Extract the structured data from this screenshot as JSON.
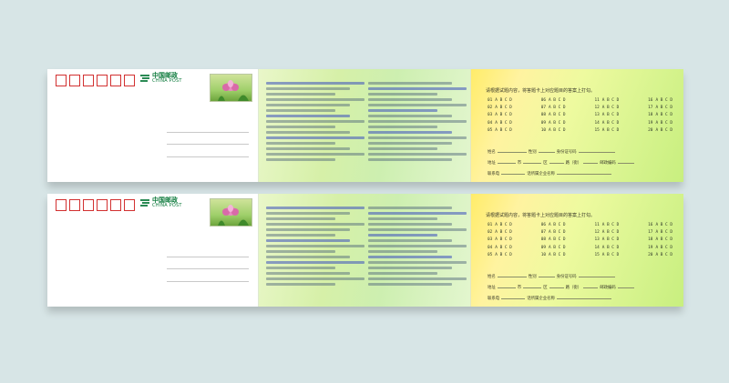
{
  "postcard": {
    "logo_cn": "中国邮政",
    "logo_en": "CHINA POST"
  },
  "reply": {
    "instruction": "请根据试题内容，将答题卡上对应题目的答案上打勾。",
    "choice_letters": "A B C D",
    "fields": [
      {
        "label": "姓名"
      },
      {
        "label": "性别"
      },
      {
        "label": "身份证号码"
      },
      {
        "label": "地址"
      },
      {
        "label": "市"
      },
      {
        "label": "区"
      },
      {
        "label": "路（街）"
      },
      {
        "label": "邮政编码"
      },
      {
        "label": "联系电"
      },
      {
        "label": "话所属企业名称"
      }
    ]
  },
  "colors": {
    "background": "#d7e5e6",
    "zip_box": "#d23030",
    "logo": "#0d7a3c"
  }
}
